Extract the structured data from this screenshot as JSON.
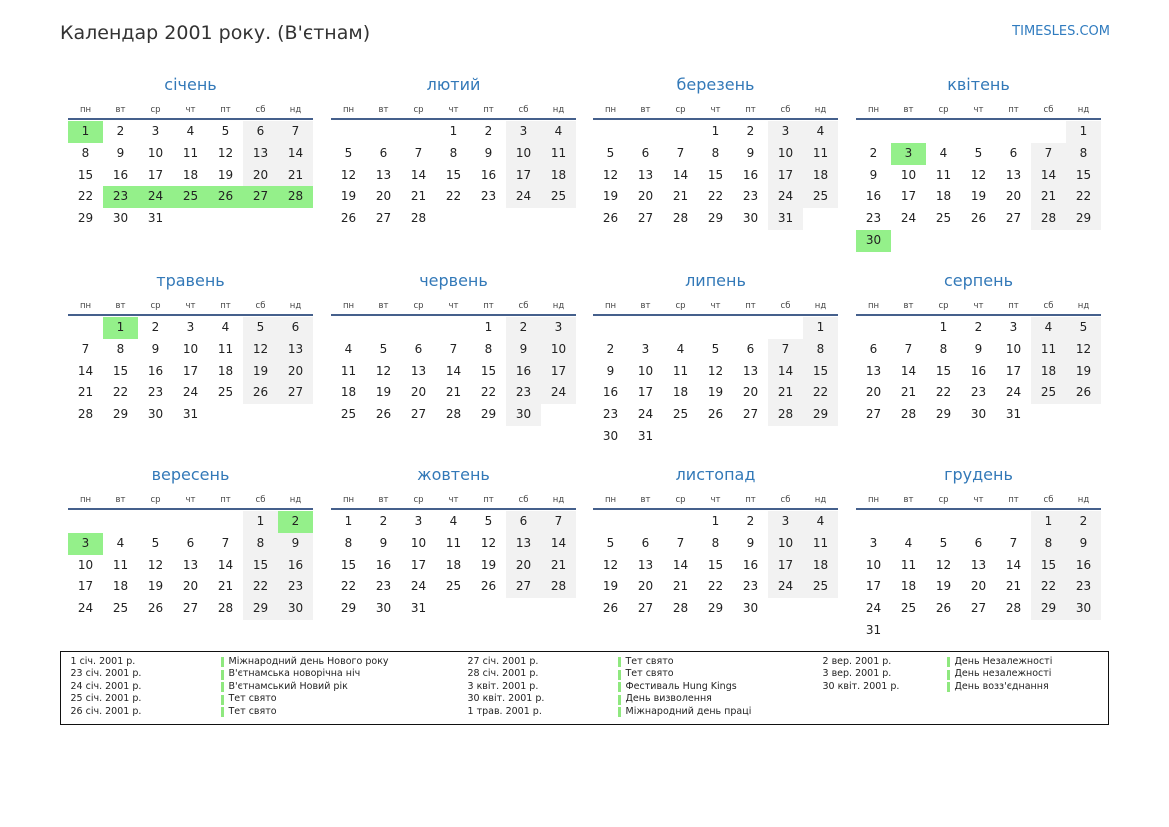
{
  "title": "Календар 2001 року. (В'єтнам)",
  "site": "TIMESLES.COM",
  "colors": {
    "accent": "#2f7bbf",
    "month_name": "#3379b8",
    "rule": "#45608c",
    "weekend": "#f2f2f2",
    "holiday": "#94f08a",
    "legend_bar": "#8fe87f"
  },
  "weekdays": [
    "пн",
    "вт",
    "ср",
    "чт",
    "пт",
    "сб",
    "нд"
  ],
  "months": [
    {
      "name": "січень",
      "holidays": [
        1,
        23,
        24,
        25,
        26,
        27,
        28
      ],
      "weeks": [
        [
          1,
          2,
          3,
          4,
          5,
          6,
          7
        ],
        [
          8,
          9,
          10,
          11,
          12,
          13,
          14
        ],
        [
          15,
          16,
          17,
          18,
          19,
          20,
          21
        ],
        [
          22,
          23,
          24,
          25,
          26,
          27,
          28
        ],
        [
          29,
          30,
          31,
          null,
          null,
          null,
          null
        ]
      ]
    },
    {
      "name": "лютий",
      "holidays": [],
      "weeks": [
        [
          null,
          null,
          null,
          1,
          2,
          3,
          4
        ],
        [
          5,
          6,
          7,
          8,
          9,
          10,
          11
        ],
        [
          12,
          13,
          14,
          15,
          16,
          17,
          18
        ],
        [
          19,
          20,
          21,
          22,
          23,
          24,
          25
        ],
        [
          26,
          27,
          28,
          null,
          null,
          null,
          null
        ]
      ]
    },
    {
      "name": "березень",
      "holidays": [],
      "weeks": [
        [
          null,
          null,
          null,
          1,
          2,
          3,
          4
        ],
        [
          5,
          6,
          7,
          8,
          9,
          10,
          11
        ],
        [
          12,
          13,
          14,
          15,
          16,
          17,
          18
        ],
        [
          19,
          20,
          21,
          22,
          23,
          24,
          25
        ],
        [
          26,
          27,
          28,
          29,
          30,
          31,
          null
        ]
      ]
    },
    {
      "name": "квітень",
      "holidays": [
        3,
        30
      ],
      "weeks": [
        [
          null,
          null,
          null,
          null,
          null,
          null,
          1
        ],
        [
          2,
          3,
          4,
          5,
          6,
          7,
          8
        ],
        [
          9,
          10,
          11,
          12,
          13,
          14,
          15
        ],
        [
          16,
          17,
          18,
          19,
          20,
          21,
          22
        ],
        [
          23,
          24,
          25,
          26,
          27,
          28,
          29
        ],
        [
          30,
          null,
          null,
          null,
          null,
          null,
          null
        ]
      ]
    },
    {
      "name": "травень",
      "holidays": [
        1
      ],
      "weeks": [
        [
          null,
          1,
          2,
          3,
          4,
          5,
          6
        ],
        [
          7,
          8,
          9,
          10,
          11,
          12,
          13
        ],
        [
          14,
          15,
          16,
          17,
          18,
          19,
          20
        ],
        [
          21,
          22,
          23,
          24,
          25,
          26,
          27
        ],
        [
          28,
          29,
          30,
          31,
          null,
          null,
          null
        ]
      ]
    },
    {
      "name": "червень",
      "holidays": [],
      "weeks": [
        [
          null,
          null,
          null,
          null,
          1,
          2,
          3
        ],
        [
          4,
          5,
          6,
          7,
          8,
          9,
          10
        ],
        [
          11,
          12,
          13,
          14,
          15,
          16,
          17
        ],
        [
          18,
          19,
          20,
          21,
          22,
          23,
          24
        ],
        [
          25,
          26,
          27,
          28,
          29,
          30,
          null
        ]
      ]
    },
    {
      "name": "липень",
      "holidays": [],
      "weeks": [
        [
          null,
          null,
          null,
          null,
          null,
          null,
          1
        ],
        [
          2,
          3,
          4,
          5,
          6,
          7,
          8
        ],
        [
          9,
          10,
          11,
          12,
          13,
          14,
          15
        ],
        [
          16,
          17,
          18,
          19,
          20,
          21,
          22
        ],
        [
          23,
          24,
          25,
          26,
          27,
          28,
          29
        ],
        [
          30,
          31,
          null,
          null,
          null,
          null,
          null
        ]
      ]
    },
    {
      "name": "серпень",
      "holidays": [],
      "weeks": [
        [
          null,
          null,
          1,
          2,
          3,
          4,
          5
        ],
        [
          6,
          7,
          8,
          9,
          10,
          11,
          12
        ],
        [
          13,
          14,
          15,
          16,
          17,
          18,
          19
        ],
        [
          20,
          21,
          22,
          23,
          24,
          25,
          26
        ],
        [
          27,
          28,
          29,
          30,
          31,
          null,
          null
        ]
      ]
    },
    {
      "name": "вересень",
      "holidays": [
        2,
        3
      ],
      "weeks": [
        [
          null,
          null,
          null,
          null,
          null,
          1,
          2
        ],
        [
          3,
          4,
          5,
          6,
          7,
          8,
          9
        ],
        [
          10,
          11,
          12,
          13,
          14,
          15,
          16
        ],
        [
          17,
          18,
          19,
          20,
          21,
          22,
          23
        ],
        [
          24,
          25,
          26,
          27,
          28,
          29,
          30
        ]
      ]
    },
    {
      "name": "жовтень",
      "holidays": [],
      "weeks": [
        [
          1,
          2,
          3,
          4,
          5,
          6,
          7
        ],
        [
          8,
          9,
          10,
          11,
          12,
          13,
          14
        ],
        [
          15,
          16,
          17,
          18,
          19,
          20,
          21
        ],
        [
          22,
          23,
          24,
          25,
          26,
          27,
          28
        ],
        [
          29,
          30,
          31,
          null,
          null,
          null,
          null
        ]
      ]
    },
    {
      "name": "листопад",
      "holidays": [],
      "weeks": [
        [
          null,
          null,
          null,
          1,
          2,
          3,
          4
        ],
        [
          5,
          6,
          7,
          8,
          9,
          10,
          11
        ],
        [
          12,
          13,
          14,
          15,
          16,
          17,
          18
        ],
        [
          19,
          20,
          21,
          22,
          23,
          24,
          25
        ],
        [
          26,
          27,
          28,
          29,
          30,
          null,
          null
        ]
      ]
    },
    {
      "name": "грудень",
      "holidays": [],
      "weeks": [
        [
          null,
          null,
          null,
          null,
          null,
          1,
          2
        ],
        [
          3,
          4,
          5,
          6,
          7,
          8,
          9
        ],
        [
          10,
          11,
          12,
          13,
          14,
          15,
          16
        ],
        [
          17,
          18,
          19,
          20,
          21,
          22,
          23
        ],
        [
          24,
          25,
          26,
          27,
          28,
          29,
          30
        ],
        [
          31,
          null,
          null,
          null,
          null,
          null,
          null
        ]
      ]
    }
  ],
  "legend": {
    "columns": [
      [
        {
          "date": "1 січ. 2001 р.",
          "name": "Міжнародний день Нового року"
        },
        {
          "date": "23 січ. 2001 р.",
          "name": "В'єтнамська новорічна ніч"
        },
        {
          "date": "24 січ. 2001 р.",
          "name": "В'єтнамський Новий рік"
        },
        {
          "date": "25 січ. 2001 р.",
          "name": "Тет свято"
        },
        {
          "date": "26 січ. 2001 р.",
          "name": "Тет свято"
        }
      ],
      [
        {
          "date": "27 січ. 2001 р.",
          "name": "Тет свято"
        },
        {
          "date": "28 січ. 2001 р.",
          "name": "Тет свято"
        },
        {
          "date": "3 квіт. 2001 р.",
          "name": "Фестиваль Hung Kings"
        },
        {
          "date": "30 квіт. 2001 р.",
          "name": "День визволення"
        },
        {
          "date": "1 трав. 2001 р.",
          "name": "Міжнародний день праці"
        }
      ],
      [
        {
          "date": "2 вер. 2001 р.",
          "name": "День Незалежності"
        },
        {
          "date": "3 вер. 2001 р.",
          "name": "День незалежності"
        },
        {
          "date": "30 квіт. 2001 р.",
          "name": "День возз'єднання"
        }
      ]
    ]
  }
}
